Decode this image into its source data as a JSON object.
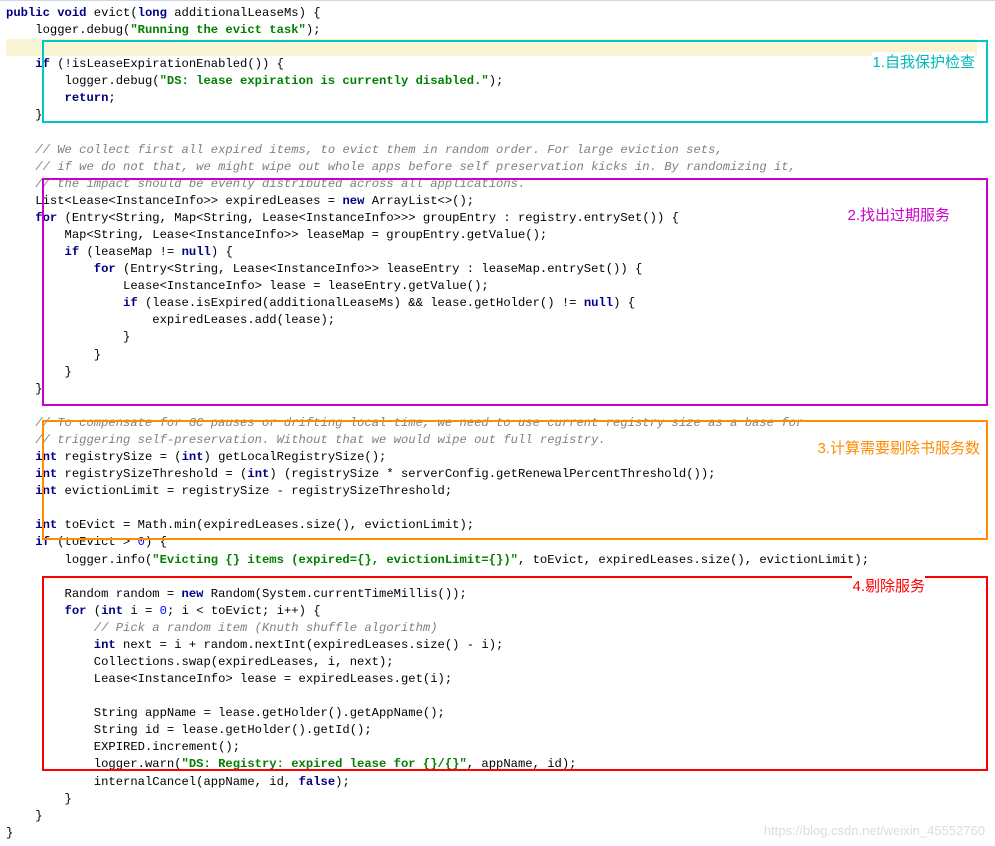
{
  "code": {
    "l01": "public void evict(long additionalLeaseMs) {",
    "l02": "    logger.debug(\"Running the evict task\");",
    "l03": "",
    "l04": "    if (!isLeaseExpirationEnabled()) {",
    "l05": "        logger.debug(\"DS: lease expiration is currently disabled.\");",
    "l06": "        return;",
    "l07": "    }",
    "l08": "",
    "l09": "    // We collect first all expired items, to evict them in random order. For large eviction sets,",
    "l10": "    // if we do not that, we might wipe out whole apps before self preservation kicks in. By randomizing it,",
    "l11": "    // the impact should be evenly distributed across all applications.",
    "l12": "    List<Lease<InstanceInfo>> expiredLeases = new ArrayList<>();",
    "l13": "    for (Entry<String, Map<String, Lease<InstanceInfo>>> groupEntry : registry.entrySet()) {",
    "l14": "        Map<String, Lease<InstanceInfo>> leaseMap = groupEntry.getValue();",
    "l15": "        if (leaseMap != null) {",
    "l16": "            for (Entry<String, Lease<InstanceInfo>> leaseEntry : leaseMap.entrySet()) {",
    "l17": "                Lease<InstanceInfo> lease = leaseEntry.getValue();",
    "l18": "                if (lease.isExpired(additionalLeaseMs) && lease.getHolder() != null) {",
    "l19": "                    expiredLeases.add(lease);",
    "l20": "                }",
    "l21": "            }",
    "l22": "        }",
    "l23": "    }",
    "l24": "",
    "l25": "    // To compensate for GC pauses or drifting local time, we need to use current registry size as a base for",
    "l26": "    // triggering self-preservation. Without that we would wipe out full registry.",
    "l27": "    int registrySize = (int) getLocalRegistrySize();",
    "l28": "    int registrySizeThreshold = (int) (registrySize * serverConfig.getRenewalPercentThreshold());",
    "l29": "    int evictionLimit = registrySize - registrySizeThreshold;",
    "l30": "",
    "l31": "    int toEvict = Math.min(expiredLeases.size(), evictionLimit);",
    "l32": "    if (toEvict > 0) {",
    "l33": "        logger.info(\"Evicting {} items (expired={}, evictionLimit={})\", toEvict, expiredLeases.size(), evictionLimit);",
    "l34": "",
    "l35": "        Random random = new Random(System.currentTimeMillis());",
    "l36": "        for (int i = 0; i < toEvict; i++) {",
    "l37": "            // Pick a random item (Knuth shuffle algorithm)",
    "l38": "            int next = i + random.nextInt(expiredLeases.size() - i);",
    "l39": "            Collections.swap(expiredLeases, i, next);",
    "l40": "            Lease<InstanceInfo> lease = expiredLeases.get(i);",
    "l41": "",
    "l42": "            String appName = lease.getHolder().getAppName();",
    "l43": "            String id = lease.getHolder().getId();",
    "l44": "            EXPIRED.increment();",
    "l45": "            logger.warn(\"DS: Registry: expired lease for {}/{}\", appName, id);",
    "l46": "            internalCancel(appName, id, false);",
    "l47": "        }",
    "l48": "    }",
    "l49": "}"
  },
  "labels": {
    "l1": "1.自我保护检查",
    "l2": "2.找出过期服务",
    "l3": "3.计算需要剔除书服务数",
    "l4": "4.剔除服务"
  },
  "watermark": "https://blog.csdn.net/weixin_45552760"
}
